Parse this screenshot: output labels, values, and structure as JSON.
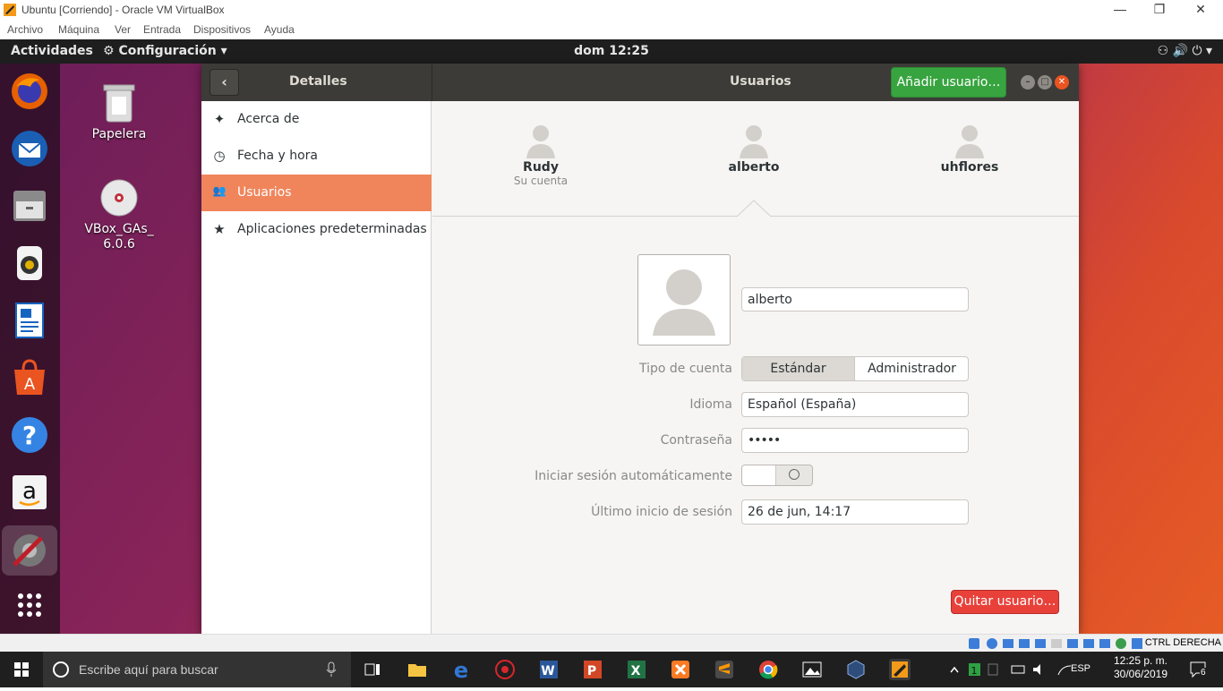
{
  "host": {
    "title": "Ubuntu [Corriendo] - Oracle VM VirtualBox",
    "controls": {
      "minimize": "—",
      "restore": "❐",
      "close": "✕"
    },
    "menu": [
      "Archivo",
      "Máquina",
      "Ver",
      "Entrada",
      "Dispositivos",
      "Ayuda"
    ],
    "status_right": "CTRL DERECHA"
  },
  "gnome": {
    "activities": "Actividades",
    "app_menu": "Configuración",
    "app_menu_arrow": "▾",
    "clock": "dom 12:25",
    "tray": "⚇  🔊  ⏻ ▾"
  },
  "desktop": {
    "icons": [
      {
        "label": "Papelera"
      },
      {
        "label": "VBox_GAs_\n6.0.6"
      }
    ]
  },
  "dock": {
    "apps": [
      "firefox-icon",
      "thunderbird-icon",
      "files-icon",
      "rhythmbox-icon",
      "writer-icon",
      "software-icon",
      "help-icon",
      "amazon-icon",
      "settings-icon",
      "show-apps-icon"
    ]
  },
  "settings": {
    "header": {
      "back": "‹",
      "panel_title": "Detalles",
      "page_title": "Usuarios",
      "add_button": "Añadir usuario…"
    },
    "sidebar": [
      {
        "icon": "✦",
        "label": "Acerca de",
        "selected": false
      },
      {
        "icon": "◷",
        "label": "Fecha y hora",
        "selected": false
      },
      {
        "icon": "👥",
        "label": "Usuarios",
        "selected": true
      },
      {
        "icon": "★",
        "label": "Aplicaciones predeterminadas",
        "selected": false
      }
    ],
    "users": [
      {
        "name": "Rudy",
        "subtitle": "Su cuenta"
      },
      {
        "name": "alberto",
        "subtitle": ""
      },
      {
        "name": "uhflores",
        "subtitle": ""
      }
    ],
    "form": {
      "username": "alberto",
      "account_type_label": "Tipo de cuenta",
      "account_type_options": [
        "Estándar",
        "Administrador"
      ],
      "account_type_selected": "Estándar",
      "language_label": "Idioma",
      "language_value": "Español (España)",
      "password_label": "Contraseña",
      "password_value": "•••••",
      "autologin_label": "Iniciar sesión automáticamente",
      "autologin_on": false,
      "last_login_label": "Último inicio de sesión",
      "last_login_value": "26 de jun, 14:17"
    },
    "remove_button": "Quitar usuario…"
  },
  "taskbar": {
    "search_placeholder": "Escribe aquí para buscar",
    "lang": "ESP",
    "time": "12:25 p. m.",
    "date": "30/06/2019",
    "notifications": "6"
  }
}
